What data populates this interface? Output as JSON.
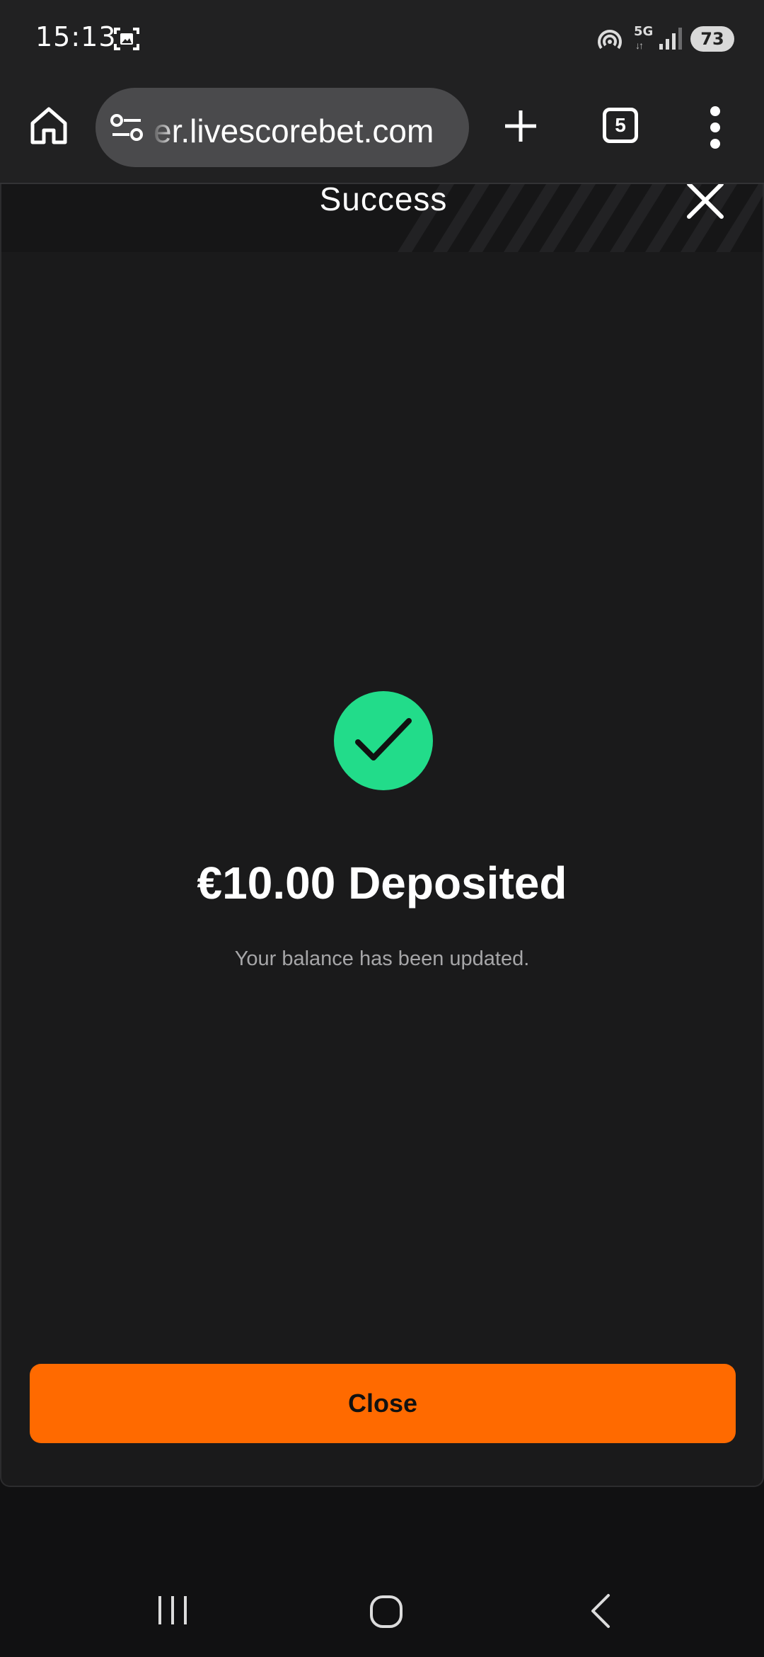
{
  "status_bar": {
    "time": "15:13",
    "network": "5G",
    "battery": "73",
    "icons": [
      "screenshot-icon",
      "hotspot-icon",
      "signal-icon",
      "battery-icon"
    ]
  },
  "browser": {
    "url": "er.livescorebet.com",
    "tab_count": "5",
    "icons": [
      "home-icon",
      "site-settings-icon",
      "plus-icon",
      "tabs-icon",
      "more-vert-icon"
    ]
  },
  "modal": {
    "title": "Success",
    "amount_title": "€10.00 Deposited",
    "subtitle": "Your balance has been updated.",
    "close_button": "Close",
    "colors": {
      "accent": "#ff6a00",
      "success": "#22dc8a",
      "background": "#1a1a1b"
    }
  },
  "nav_bar": {
    "icons": [
      "recents-icon",
      "home-circle-icon",
      "back-icon"
    ]
  }
}
